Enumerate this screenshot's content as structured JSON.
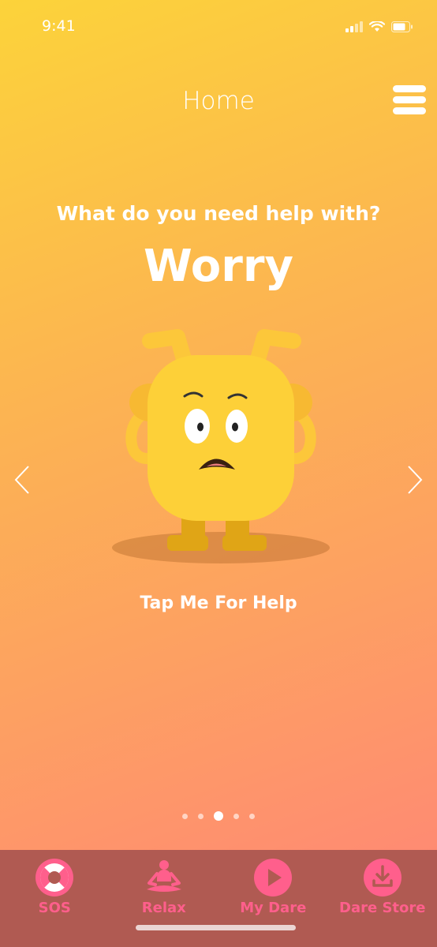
{
  "status_bar": {
    "time": "9:41"
  },
  "header": {
    "title": "Home"
  },
  "main": {
    "question": "What do you need help with?",
    "topic": "Worry",
    "tap_label": "Tap Me For Help"
  },
  "pager": {
    "total": 5,
    "active_index": 2
  },
  "tab_bar": {
    "items": [
      {
        "label": "SOS",
        "icon": "lifebuoy-icon"
      },
      {
        "label": "Relax",
        "icon": "meditation-icon"
      },
      {
        "label": "My Dare",
        "icon": "play-icon"
      },
      {
        "label": "Dare Store",
        "icon": "download-icon"
      }
    ]
  },
  "colors": {
    "gradient_top": "#FCD33A",
    "gradient_bottom": "#FF8478",
    "tab_bar_bg": "#B05A52",
    "tab_accent": "#FF5F8C",
    "mascot_body": "#FDD038"
  }
}
